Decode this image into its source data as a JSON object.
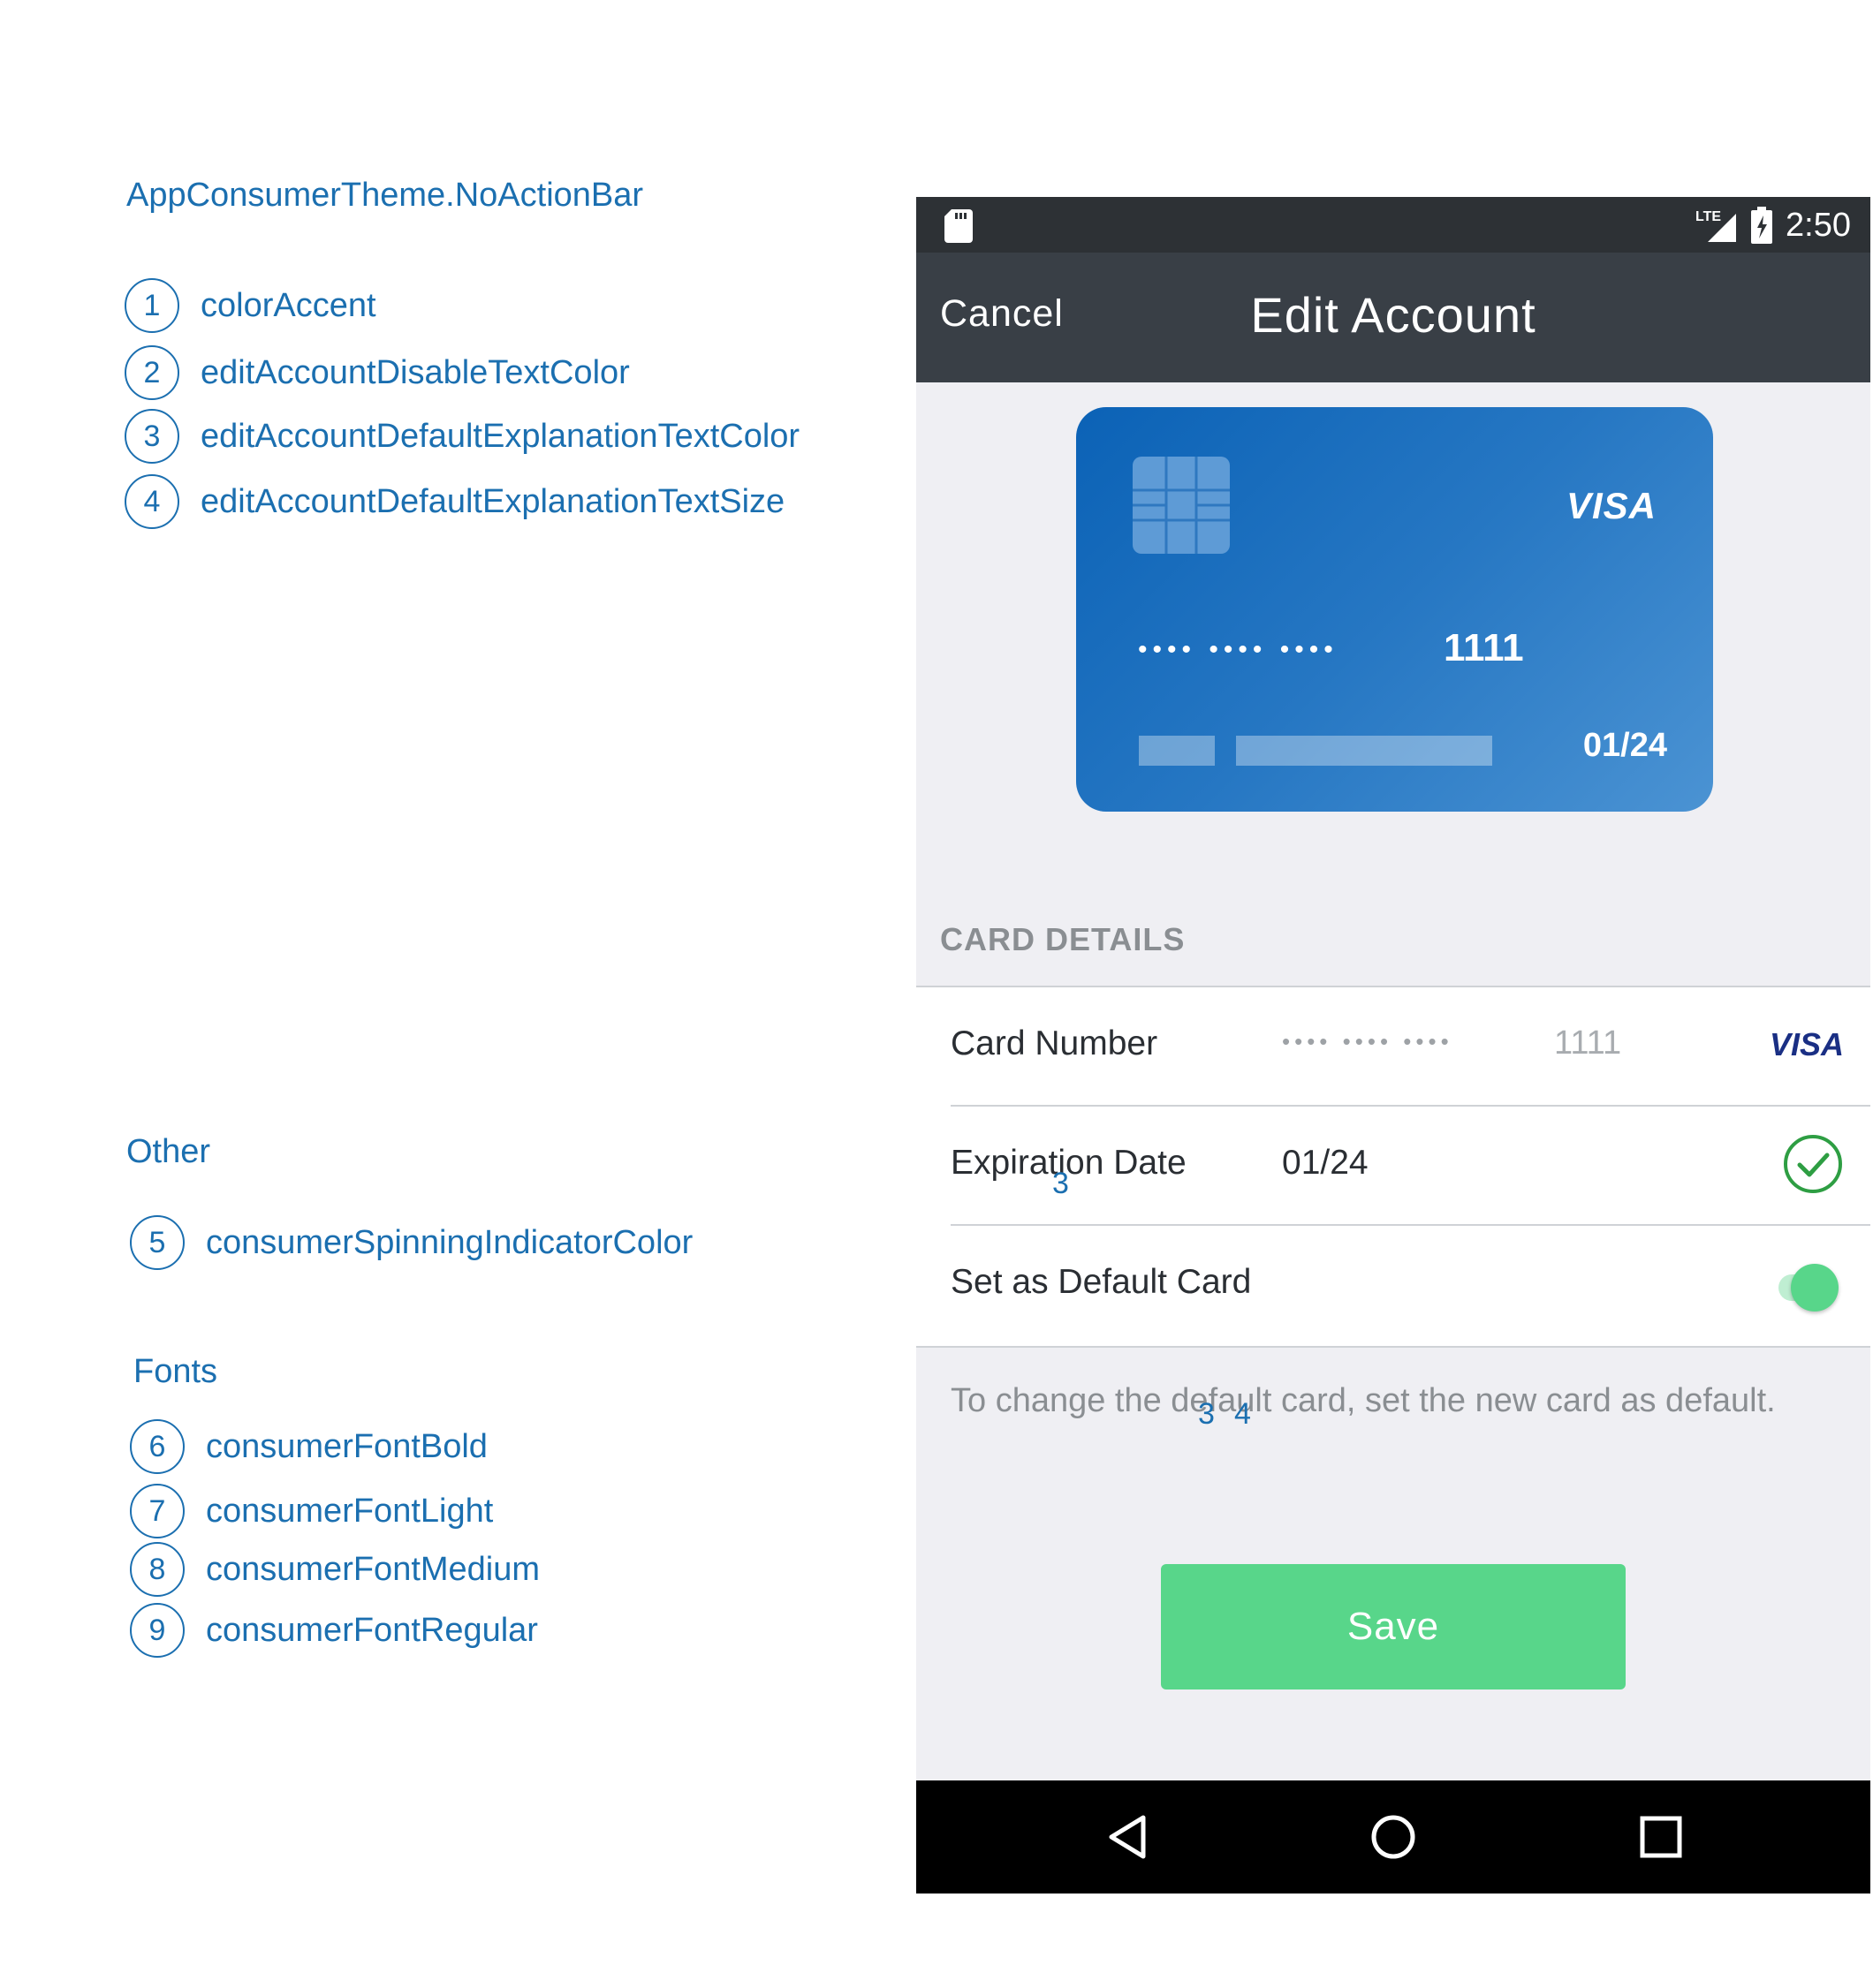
{
  "legend": {
    "theme_title": "AppConsumerTheme.NoActionBar",
    "theme_items": [
      {
        "num": "1",
        "label": "colorAccent"
      },
      {
        "num": "2",
        "label": "editAccountDisableTextColor"
      },
      {
        "num": "3",
        "label": "editAccountDefaultExplanationTextColor"
      },
      {
        "num": "4",
        "label": "editAccountDefaultExplanationTextSize"
      }
    ],
    "other_title": "Other",
    "other_items": [
      {
        "num": "5",
        "label": "consumerSpinningIndicatorColor"
      }
    ],
    "fonts_title": "Fonts",
    "font_items": [
      {
        "num": "6",
        "label": "consumerFontBold"
      },
      {
        "num": "7",
        "label": "consumerFontLight"
      },
      {
        "num": "8",
        "label": "consumerFontMedium"
      },
      {
        "num": "9",
        "label": "consumerFontRegular"
      }
    ]
  },
  "status_bar": {
    "network": "LTE",
    "time": "2:50"
  },
  "app_bar": {
    "cancel_label": "Cancel",
    "title": "Edit Account"
  },
  "card": {
    "brand": "VISA",
    "masked_groups": "•••• •••• ••••",
    "last4": "1111",
    "expiry": "01/24"
  },
  "card_details": {
    "header": "CARD DETAILS",
    "card_number_label": "Card Number",
    "card_number_masked": "•••• •••• ••••",
    "card_number_last4": "1111",
    "card_brand": "VISA",
    "expiration_label": "Expiration Date",
    "expiration_value": "01/24",
    "default_label": "Set as Default Card",
    "default_toggle_on": true
  },
  "explanation": "To change the default card, set the new card as default.",
  "markers": {
    "expiration": "3",
    "explanation_a": "3",
    "explanation_b": "4"
  },
  "save_label": "Save",
  "colors": {
    "accent_blue": "#1b6fb0",
    "save_green": "#58d68a",
    "appbar": "#393f46",
    "statusbar": "#2d3135",
    "check_green": "#2e9e43"
  }
}
